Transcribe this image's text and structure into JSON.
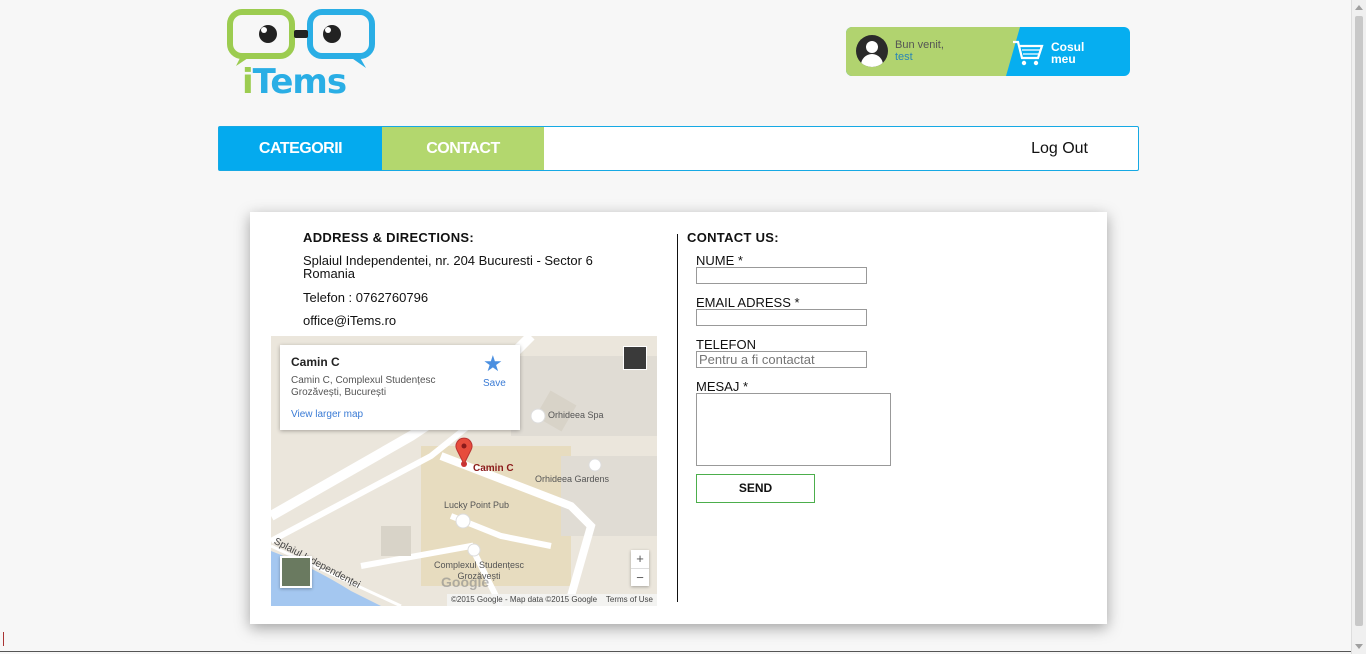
{
  "brand": {
    "name_i": "i",
    "name_rest": "Tems"
  },
  "userbox": {
    "greeting": "Bun venit,",
    "username": "test",
    "cart_line1": "Cosul",
    "cart_line2": "meu"
  },
  "nav": {
    "items": [
      {
        "label": "CATEGORII"
      },
      {
        "label": "CONTACT"
      }
    ],
    "logout": "Log Out"
  },
  "address": {
    "title": "ADDRESS & DIRECTIONS:",
    "street": "Splaiul Independentei, nr. 204 Bucuresti - Sector 6 Romania",
    "phone": "Telefon : 0762760796",
    "email": "office@iTems.ro"
  },
  "map": {
    "card_title": "Camin C",
    "card_address": "Camin C, Complexul Studențesc Grozăvești, București",
    "card_link": "View larger map",
    "save": "Save",
    "pin_label": "Camin C",
    "labels": {
      "spa": "Orhideea Spa",
      "gardens": "Orhideea Gardens",
      "pub": "Lucky Point Pub",
      "complex": "Complexul Studențesc Grozăvești",
      "road": "Splaiul Independenței"
    },
    "zoom_in": "+",
    "zoom_out": "−",
    "google": "Google",
    "footer_copy": "©2015 Google - Map data ©2015 Google",
    "footer_terms": "Terms of Use"
  },
  "contact": {
    "title": "CONTACT US:",
    "name_label": "NUME *",
    "email_label": "EMAIL ADRESS *",
    "phone_label": "TELEFON",
    "phone_placeholder": "Pentru a fi contactat",
    "message_label": "MESAJ *",
    "send": "SEND"
  },
  "colors": {
    "blue": "#04aaee",
    "green": "#b3d76e",
    "logo_green": "#9ccc50",
    "logo_blue": "#2aaee5"
  }
}
